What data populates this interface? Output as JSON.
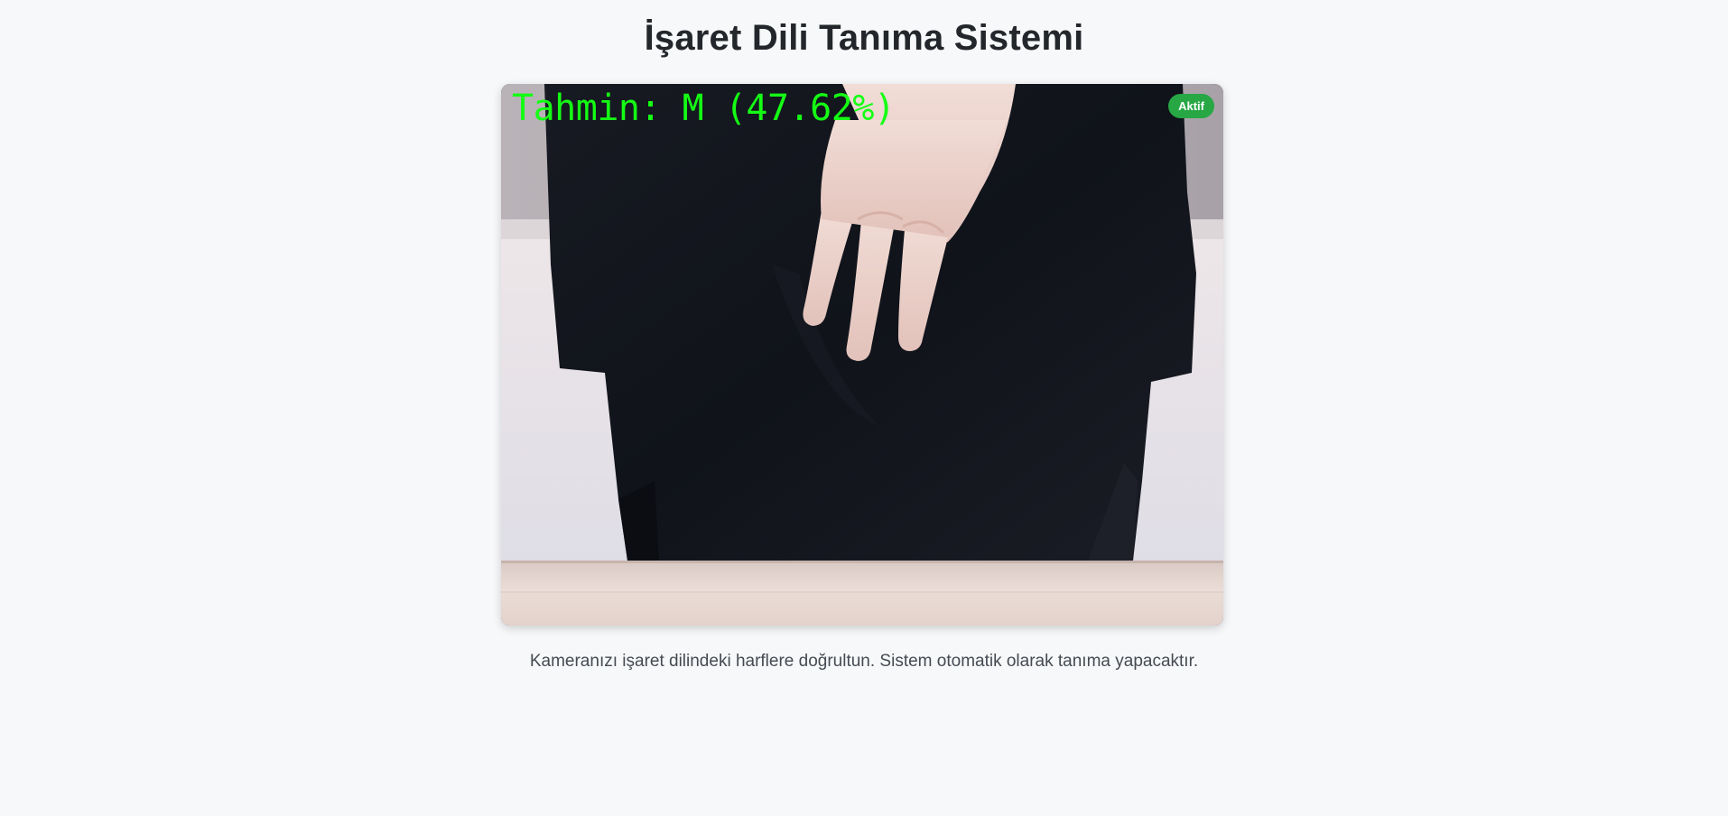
{
  "page": {
    "title": "İşaret Dili Tanıma Sistemi",
    "instructions": "Kameranızı işaret dilindeki harflere doğrultun. Sistem otomatik olarak tanıma yapacaktır."
  },
  "camera": {
    "prediction_text": "Tahmin: M (47.62%)",
    "status_badge": "Aktif",
    "colors": {
      "prediction": "#14ff14",
      "badge": "#28a745"
    }
  }
}
